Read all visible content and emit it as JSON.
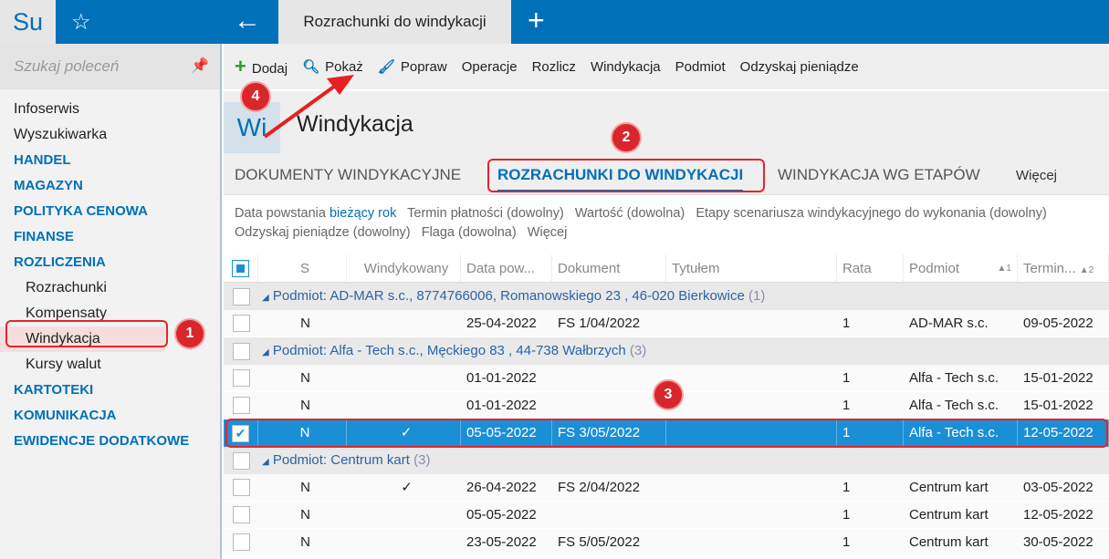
{
  "topbar": {
    "logo": "Su",
    "tab_title": "Rozrachunki do windykacji"
  },
  "sidebar": {
    "search_placeholder": "Szukaj poleceń",
    "items": [
      {
        "label": "Infoserwis",
        "type": "item"
      },
      {
        "label": "Wyszukiwarka",
        "type": "item"
      },
      {
        "label": "HANDEL",
        "type": "sec"
      },
      {
        "label": "MAGAZYN",
        "type": "sec"
      },
      {
        "label": "POLITYKA CENOWA",
        "type": "sec"
      },
      {
        "label": "FINANSE",
        "type": "sec"
      },
      {
        "label": "ROZLICZENIA",
        "type": "sec"
      },
      {
        "label": "Rozrachunki",
        "type": "sub"
      },
      {
        "label": "Kompensaty",
        "type": "sub"
      },
      {
        "label": "Windykacja",
        "type": "sub act"
      },
      {
        "label": "Kursy walut",
        "type": "sub"
      },
      {
        "label": "KARTOTEKI",
        "type": "sec"
      },
      {
        "label": "KOMUNIKACJA",
        "type": "sec"
      },
      {
        "label": "EWIDENCJE DODATKOWE",
        "type": "sec"
      }
    ]
  },
  "toolbar": {
    "add": "Dodaj",
    "show": "Pokaż",
    "edit": "Popraw",
    "operations": "Operacje",
    "settle": "Rozlicz",
    "collection": "Windykacja",
    "entity": "Podmiot",
    "recover": "Odzyskaj pieniądze"
  },
  "page": {
    "icon": "Wi",
    "title": "Windykacja"
  },
  "tabs": {
    "t1": "DOKUMENTY WINDYKACYJNE",
    "t2": "ROZRACHUNKI DO WINDYKACJI",
    "t3": "WINDYKACJA WG ETAPÓW",
    "more": "Więcej"
  },
  "filters": {
    "f1_label": "Data powstania",
    "f1_value": "bieżący rok",
    "f2": "Termin płatności (dowolny)",
    "f3": "Wartość (dowolna)",
    "f4": "Etapy scenariusza windykacyjnego do wykonania (dowolny)",
    "f5": "Odzyskaj pieniądze (dowolny)",
    "f6": "Flaga (dowolna)",
    "more": "Więcej"
  },
  "grid": {
    "headers": [
      "S",
      "Windykowany",
      "Data pow...",
      "Dokument",
      "Tytułem",
      "Rata",
      "Podmiot",
      "Termin..."
    ],
    "sort1": "▲1",
    "sort2": "▲2",
    "rows": [
      {
        "group": "Podmiot: AD-MAR s.c., 8774766006, Romanowskiego 23 , 46-020 Bierkowice",
        "count": "(1)"
      },
      {
        "cells": [
          "N",
          "",
          "25-04-2022",
          "FS 1/04/2022",
          "",
          "1",
          "AD-MAR s.c.",
          "09-05-2022"
        ]
      },
      {
        "group": "Podmiot: Alfa - Tech s.c., Męckiego  83 , 44-738 Wałbrzych",
        "count": "(3)"
      },
      {
        "cells": [
          "N",
          "",
          "01-01-2022",
          "",
          "",
          "1",
          "Alfa - Tech s.c.",
          "15-01-2022"
        ]
      },
      {
        "cells": [
          "N",
          "",
          "01-01-2022",
          "",
          "",
          "1",
          "Alfa - Tech s.c.",
          "15-01-2022"
        ]
      },
      {
        "cells": [
          "N",
          "✓",
          "05-05-2022",
          "FS 3/05/2022",
          "",
          "1",
          "Alfa - Tech s.c.",
          "12-05-2022"
        ],
        "selected": true
      },
      {
        "group": "Podmiot: Centrum kart",
        "count": "(3)"
      },
      {
        "cells": [
          "N",
          "✓",
          "26-04-2022",
          "FS 2/04/2022",
          "",
          "1",
          "Centrum kart",
          "03-05-2022"
        ]
      },
      {
        "cells": [
          "N",
          "",
          "05-05-2022",
          "",
          "",
          "1",
          "Centrum kart",
          "12-05-2022"
        ]
      },
      {
        "cells": [
          "N",
          "",
          "23-05-2022",
          "FS 5/05/2022",
          "",
          "1",
          "Centrum kart",
          "30-05-2022"
        ]
      }
    ]
  },
  "annotations": [
    "1",
    "2",
    "3",
    "4"
  ],
  "colors": {
    "brand": "#0070b8",
    "selected": "#1b8fd6",
    "annotation": "#d9262c"
  }
}
